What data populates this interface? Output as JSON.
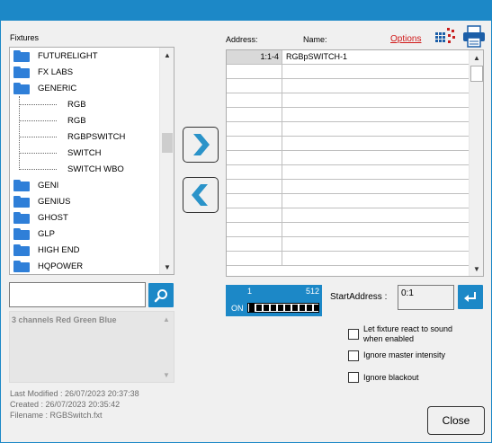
{
  "window": {
    "title_bar_color": "#1c88c7"
  },
  "left_panel": {
    "fixtures_label": "Fixtures",
    "tree": [
      {
        "label": "FUTURELIGHT",
        "type": "folder"
      },
      {
        "label": "FX LABS",
        "type": "folder"
      },
      {
        "label": "GENERIC",
        "type": "folder"
      },
      {
        "label": "RGB",
        "type": "child"
      },
      {
        "label": "RGB",
        "type": "child"
      },
      {
        "label": "RGBPSWITCH",
        "type": "child"
      },
      {
        "label": "SWITCH",
        "type": "child"
      },
      {
        "label": "SWITCH WBO",
        "type": "child"
      },
      {
        "label": "GENI",
        "type": "folder"
      },
      {
        "label": "GENIUS",
        "type": "folder"
      },
      {
        "label": "GHOST",
        "type": "folder"
      },
      {
        "label": "GLP",
        "type": "folder"
      },
      {
        "label": "HIGH END",
        "type": "folder"
      },
      {
        "label": "HQPOWER",
        "type": "folder"
      }
    ],
    "search": {
      "value": ""
    },
    "description": "3 channels Red Green Blue",
    "meta": {
      "last_modified": "Last Modified : 26/07/2023 20:37:38",
      "created": "Created : 26/07/2023 20:35:42",
      "filename": "Filename : RGBSwitch.fxt"
    }
  },
  "right_panel": {
    "address_header": "Address:",
    "name_header": "Name:",
    "options_link": "Options",
    "rows": [
      {
        "address": "1:1-4",
        "name": "RGBpSWITCH-1"
      }
    ],
    "empty_rows": 14,
    "dmx": {
      "start": "1",
      "end": "512",
      "on": "ON"
    },
    "start_address_label": "StartAddress :",
    "start_address_value": "0:1",
    "checkboxes": [
      {
        "label": "Let fixture react to sound when enabled",
        "checked": false
      },
      {
        "label": "Ignore master intensity",
        "checked": false
      },
      {
        "label": "Ignore blackout",
        "checked": false
      }
    ]
  },
  "close_label": "Close",
  "colors": {
    "accent": "#1c88c7",
    "link": "#d01818",
    "arrow": "#2a93c9"
  }
}
